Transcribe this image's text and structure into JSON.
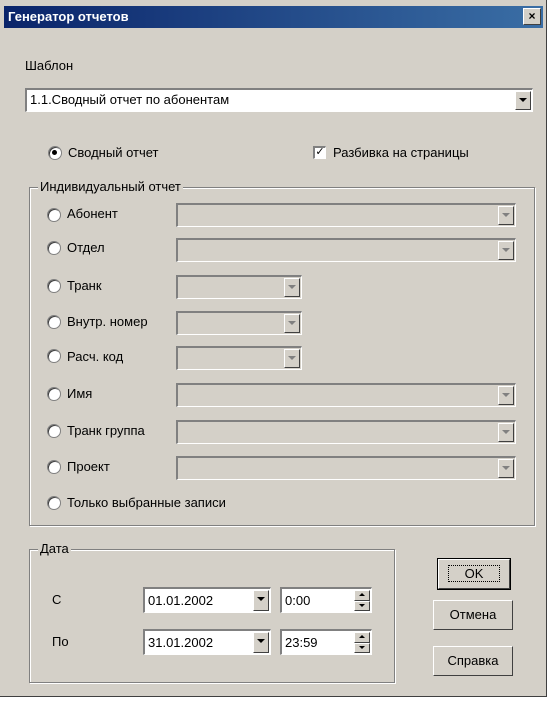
{
  "window": {
    "title": "Генератор отчетов",
    "close_glyph": "×"
  },
  "template": {
    "label": "Шаблон",
    "value": "1.1.Сводный отчет по абонентам"
  },
  "summary": {
    "label": "Сводный отчет",
    "selected": true
  },
  "paging": {
    "label": "Разбивка на страницы",
    "checked": true,
    "check_glyph": "✓"
  },
  "individual": {
    "legend": "Индивидуальный отчет",
    "options": [
      {
        "label": "Абонент"
      },
      {
        "label": "Отдел"
      },
      {
        "label": "Транк"
      },
      {
        "label": "Внутр. номер"
      },
      {
        "label": "Расч. код"
      },
      {
        "label": "Имя"
      },
      {
        "label": "Транк группа"
      },
      {
        "label": "Проект"
      },
      {
        "label": "Только выбранные записи"
      }
    ]
  },
  "date": {
    "legend": "Дата",
    "from_label": "С",
    "to_label": "По",
    "from_date": "01.01.2002",
    "from_time": "0:00",
    "to_date": "31.01.2002",
    "to_time": "23:59"
  },
  "buttons": {
    "ok": "OK",
    "cancel": "Отмена",
    "help": "Справка"
  }
}
